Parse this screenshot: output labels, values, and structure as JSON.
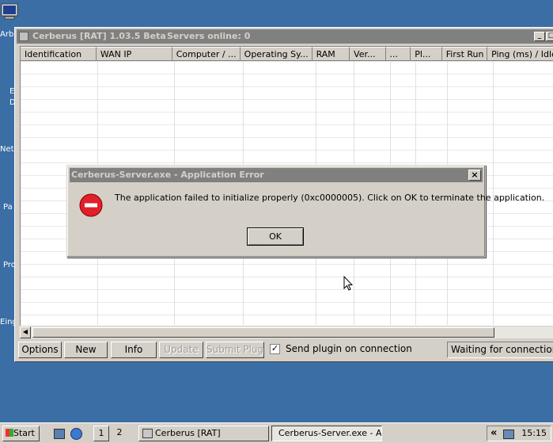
{
  "desktop": {
    "labels": [
      "Arb",
      "E",
      "D",
      "Netz",
      "Pa",
      "Pro",
      "Eing"
    ]
  },
  "main_window": {
    "title": "Cerberus [RAT] 1.03.5 Beta",
    "servers_online": "Servers online: 0",
    "columns": [
      "Identification",
      "WAN IP",
      "Computer / ...",
      "Operating Sy...",
      "RAM",
      "Ver...",
      "...",
      "Pl...",
      "First Run",
      "Ping (ms) / Idle"
    ],
    "buttons": {
      "options": "Options",
      "new": "New",
      "info": "Info",
      "update": "Update",
      "submit_plugin": "Submit Plugin"
    },
    "send_plugin_label": "Send plugin on connection",
    "send_plugin_checked": true,
    "status": "Waiting for connections on"
  },
  "error_dialog": {
    "title": "Cerberus-Server.exe - Application Error",
    "message": "The application failed to initialize properly (0xc0000005). Click on OK to terminate the application.",
    "ok_label": "OK",
    "close_label": "×"
  },
  "taskbar": {
    "start_label": "Start",
    "pager": [
      "1",
      "2"
    ],
    "tasks": [
      "Cerberus [RAT]",
      "Cerberus-Server.exe - A..."
    ],
    "tray_chevron": "«",
    "clock": "15:15"
  }
}
